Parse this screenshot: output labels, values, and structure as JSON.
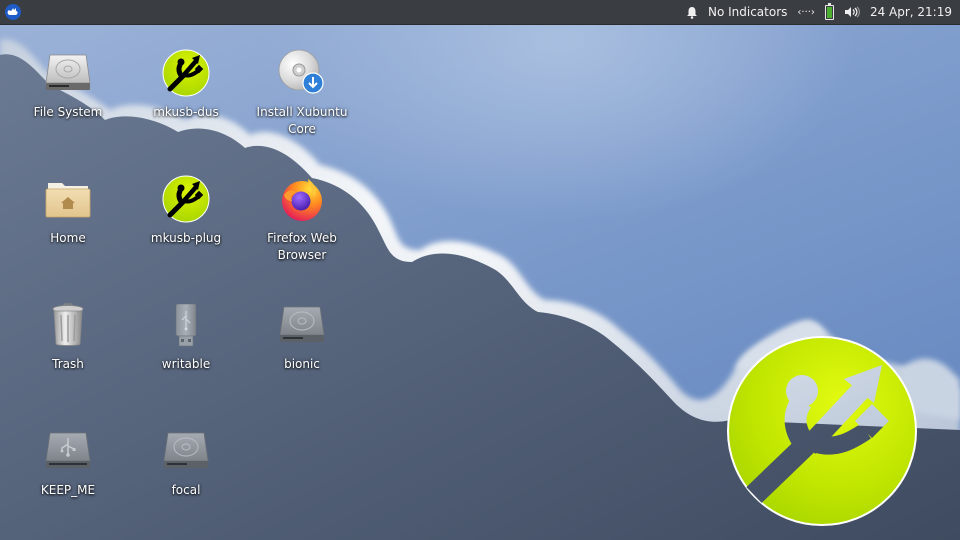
{
  "panel": {
    "menu_icon": "xubuntu-whisker-menu-icon",
    "notification_icon": "bell-icon",
    "indicator_text": "No Indicators",
    "network_icon": "network-disconnected-icon",
    "network_glyph": "‹···›",
    "battery_icon": "battery-full-icon",
    "battery_level": 1.0,
    "volume_icon": "volume-icon",
    "clock": "24 Apr, 21:19"
  },
  "desktop": {
    "icons": [
      {
        "label": "File System",
        "icon": "hard-drive-icon"
      },
      {
        "label": "mkusb-dus",
        "icon": "mkusb-icon"
      },
      {
        "label": "Install Xubuntu Core",
        "icon": "install-cd-icon"
      },
      {
        "label": "Home",
        "icon": "home-folder-icon"
      },
      {
        "label": "mkusb-plug",
        "icon": "mkusb-icon"
      },
      {
        "label": "Firefox Web Browser",
        "icon": "firefox-icon"
      },
      {
        "label": "Trash",
        "icon": "trash-icon"
      },
      {
        "label": "writable",
        "icon": "usb-stick-icon"
      },
      {
        "label": "bionic",
        "icon": "hard-drive-icon"
      },
      {
        "label": "KEEP_ME",
        "icon": "usb-drive-icon"
      },
      {
        "label": "focal",
        "icon": "hard-drive-icon"
      }
    ]
  },
  "wallpaper": {
    "logo": "mkusb-logo",
    "colors": {
      "sky": "#6f8cbd",
      "cloud_dark": "#4f5d74",
      "logo_green": "#b8e000"
    }
  }
}
